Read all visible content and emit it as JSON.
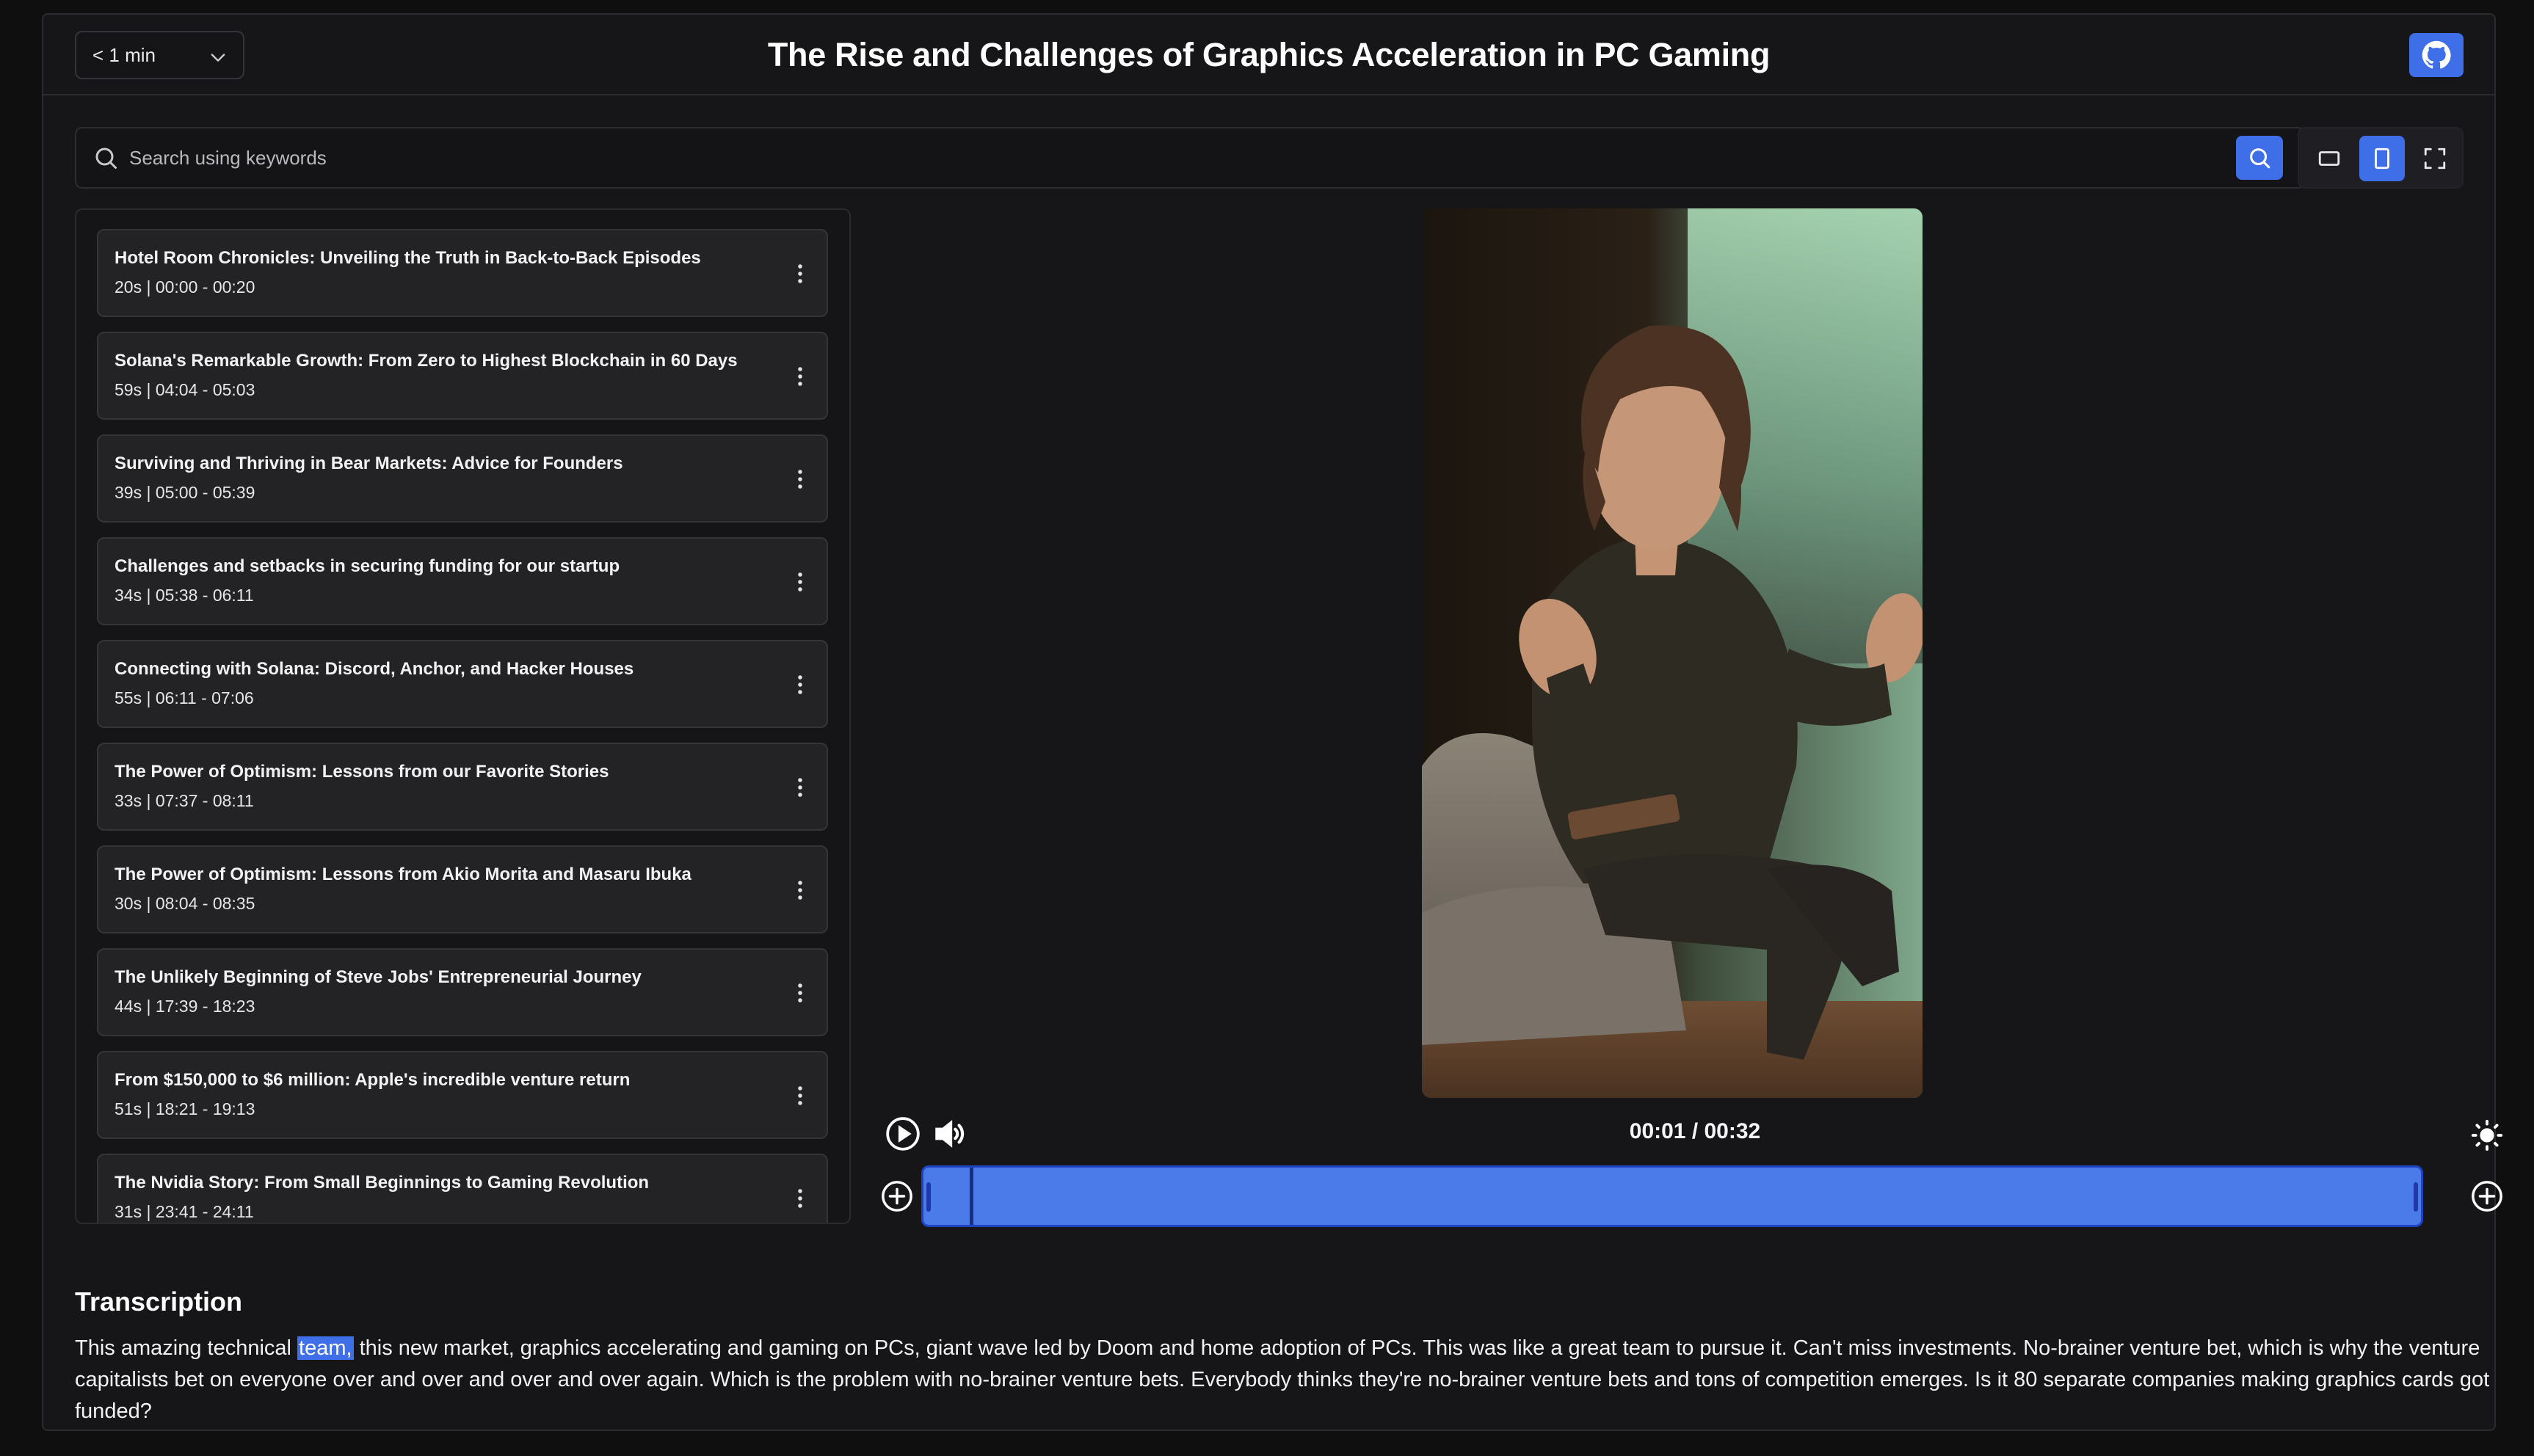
{
  "header": {
    "duration_value": "< 1 min",
    "title": "The Rise and Challenges of Graphics Acceleration in PC Gaming"
  },
  "search": {
    "placeholder": "Search using keywords"
  },
  "clips": [
    {
      "title": "Hotel Room Chronicles: Unveiling the Truth in Back-to-Back Episodes",
      "meta": "20s | 00:00 - 00:20"
    },
    {
      "title": "Solana's Remarkable Growth: From Zero to Highest Blockchain in 60 Days",
      "meta": "59s | 04:04 - 05:03"
    },
    {
      "title": "Surviving and Thriving in Bear Markets: Advice for Founders",
      "meta": "39s | 05:00 - 05:39"
    },
    {
      "title": "Challenges and setbacks in securing funding for our startup",
      "meta": "34s | 05:38 - 06:11"
    },
    {
      "title": "Connecting with Solana: Discord, Anchor, and Hacker Houses",
      "meta": "55s | 06:11 - 07:06"
    },
    {
      "title": "The Power of Optimism: Lessons from our Favorite Stories",
      "meta": "33s | 07:37 - 08:11"
    },
    {
      "title": "The Power of Optimism: Lessons from Akio Morita and Masaru Ibuka",
      "meta": "30s | 08:04 - 08:35"
    },
    {
      "title": "The Unlikely Beginning of Steve Jobs' Entrepreneurial Journey",
      "meta": "44s | 17:39 - 18:23"
    },
    {
      "title": "From $150,000 to $6 million: Apple's incredible venture return",
      "meta": "51s | 18:21 - 19:13"
    },
    {
      "title": "The Nvidia Story: From Small Beginnings to Gaming Revolution",
      "meta": "31s | 23:41 - 24:11"
    }
  ],
  "player": {
    "time": "00:01 / 00:32",
    "progress_fraction": 0.031
  },
  "transcription": {
    "heading": "Transcription",
    "before": "This amazing technical ",
    "highlight": "team,",
    "after": " this new market, graphics accelerating and gaming on PCs, giant wave led by Doom and home adoption of PCs. This was like a great team to pursue it. Can't miss investments. No-brainer venture bet, which is why the venture capitalists bet on everyone over and over and over and over again. Which is the problem with no-brainer venture bets. Everybody thinks they're no-brainer venture bets and tons of competition emerges. Is it 80 separate companies making graphics cards got funded?"
  },
  "colors": {
    "accent": "#3e6ee8",
    "background": "#161618",
    "timeline_fill": "#4b7be8"
  },
  "icons": {
    "duration_chevron": "chevron-down-icon",
    "github": "github-icon",
    "search": "search-icon",
    "view_landscape": "landscape-view-icon",
    "view_portrait": "portrait-view-icon",
    "view_fullscreen": "fullscreen-icon",
    "clip_menu": "more-vertical-icon",
    "play": "play-icon",
    "volume": "volume-icon",
    "brightness": "sun-icon",
    "extend_start": "add-circle-icon",
    "extend_end": "add-circle-icon"
  }
}
